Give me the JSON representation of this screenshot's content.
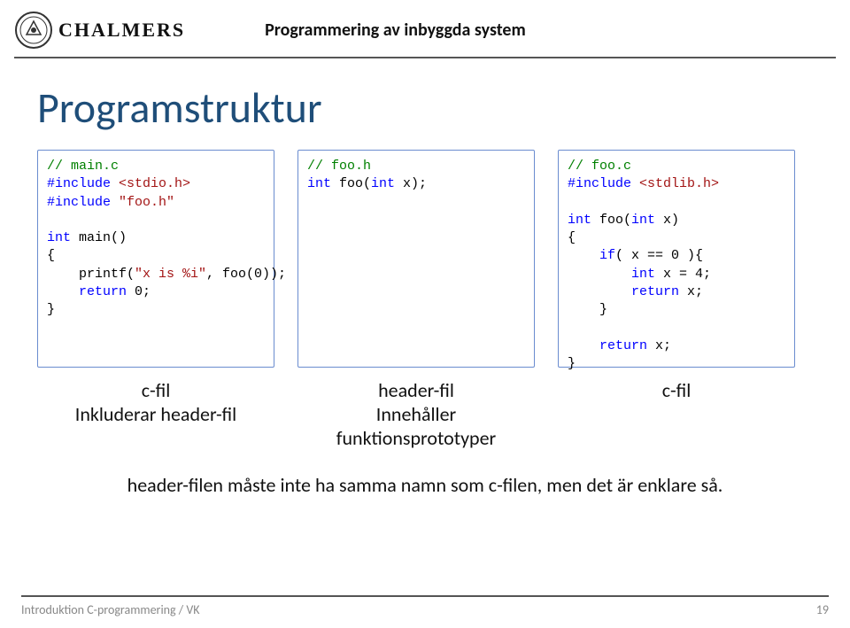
{
  "header": {
    "brand": "CHALMERS",
    "course": "Programmering av inbyggda system"
  },
  "title": "Programstruktur",
  "code": {
    "box1": {
      "l1a": "// main.c",
      "l2a": "#include ",
      "l2b": "<stdio.h>",
      "l3a": "#include ",
      "l3b": "\"foo.h\"",
      "l5a": "int",
      "l5b": " main()",
      "l6a": "{",
      "l7a": "    printf(",
      "l7b": "\"x is %i\"",
      "l7c": ", foo(0));",
      "l8a": "    ",
      "l8b": "return",
      "l8c": " 0;",
      "l9a": "}"
    },
    "box2": {
      "l1a": "// foo.h",
      "l2a": "int",
      "l2b": " foo(",
      "l2c": "int",
      "l2d": " x);"
    },
    "box3": {
      "l1a": "// foo.c",
      "l2a": "#include ",
      "l2b": "<stdlib.h>",
      "l4a": "int",
      "l4b": " foo(",
      "l4c": "int",
      "l4d": " x)",
      "l5a": "{",
      "l6a": "    ",
      "l6b": "if",
      "l6c": "( x == 0 ){",
      "l7a": "        ",
      "l7b": "int",
      "l7c": " x = 4;",
      "l8a": "        ",
      "l8b": "return",
      "l8c": " x;",
      "l9a": "    }",
      "l11a": "    ",
      "l11b": "return",
      "l11c": " x;",
      "l12a": "}"
    }
  },
  "labels": {
    "col1_line1": "c-fil",
    "col1_line2": "Inkluderar header-fil",
    "col2_line1": "header-fil",
    "col2_line2": "Innehåller",
    "col2_line3": "funktionsprototyper",
    "col3_line1": "c-fil"
  },
  "note": "header-filen måste inte ha samma namn som c-filen, men det är enklare så.",
  "footer": {
    "left": "Introduktion C-programmering / VK",
    "pagenum": "19"
  }
}
